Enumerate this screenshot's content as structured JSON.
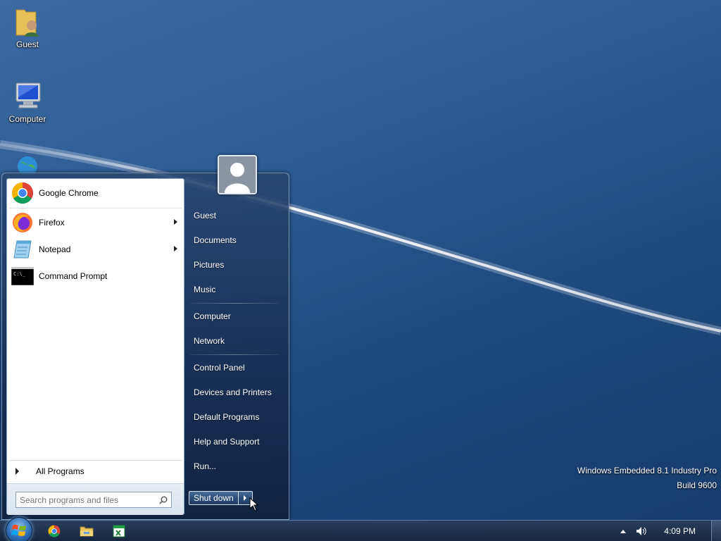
{
  "desktop": {
    "icons": [
      {
        "label": "Guest",
        "icon": "user-folder-icon"
      },
      {
        "label": "Computer",
        "icon": "computer-icon"
      },
      {
        "label": "",
        "icon": "network-icon"
      }
    ],
    "watermark": {
      "line1": "Windows Embedded 8.1 Industry Pro",
      "line2": "Build 9600"
    }
  },
  "start_menu": {
    "pinned_programs": [
      {
        "label": "Google Chrome",
        "icon": "chrome-icon",
        "has_submenu": false
      }
    ],
    "recent_programs": [
      {
        "label": "Firefox",
        "icon": "firefox-icon",
        "has_submenu": true
      },
      {
        "label": "Notepad",
        "icon": "notepad-icon",
        "has_submenu": true
      },
      {
        "label": "Command Prompt",
        "icon": "command-prompt-icon",
        "has_submenu": false
      }
    ],
    "all_programs_label": "All Programs",
    "search": {
      "placeholder": "Search programs and files",
      "value": ""
    },
    "right_items": {
      "guest": "Guest",
      "documents": "Documents",
      "pictures": "Pictures",
      "music": "Music",
      "computer": "Computer",
      "network": "Network",
      "control_panel": "Control Panel",
      "devices_printers": "Devices and Printers",
      "default_programs": "Default Programs",
      "help_support": "Help and Support",
      "run": "Run..."
    },
    "shutdown_label": "Shut down"
  },
  "taskbar": {
    "pinned": [
      "chrome-icon",
      "file-explorer-icon",
      "spreadsheet-app-icon"
    ],
    "clock": "4:09 PM"
  }
}
